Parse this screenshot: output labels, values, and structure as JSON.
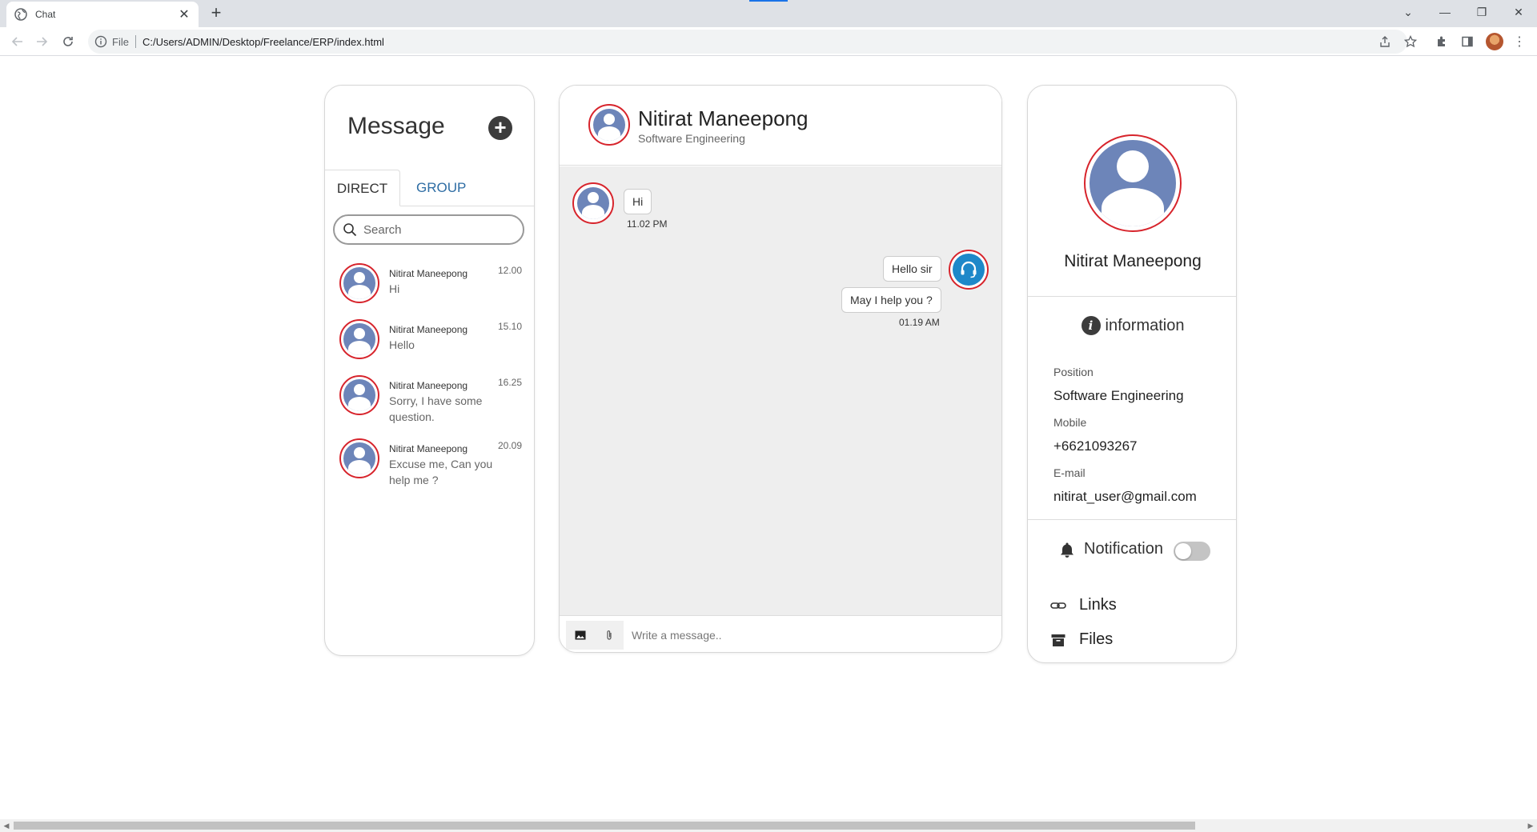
{
  "browser": {
    "tab_title": "Chat",
    "url_scheme": "File",
    "url": "C:/Users/ADMIN/Desktop/Freelance/ERP/index.html"
  },
  "left": {
    "title": "Message",
    "tabs": [
      {
        "label": "DIRECT",
        "active": true
      },
      {
        "label": "GROUP",
        "active": false
      }
    ],
    "search_placeholder": "Search",
    "conversations": [
      {
        "name": "Nitirat Maneepong",
        "time": "12.00",
        "message": "Hi"
      },
      {
        "name": "Nitirat Maneepong",
        "time": "15.10",
        "message": "Hello"
      },
      {
        "name": "Nitirat Maneepong",
        "time": "16.25",
        "message": "Sorry, I have some question."
      },
      {
        "name": "Nitirat Maneepong",
        "time": "20.09",
        "message": "Excuse me, Can you help me ?"
      }
    ]
  },
  "chat": {
    "contact_name": "Nitirat Maneepong",
    "contact_role": "Software Engineering",
    "messages": [
      {
        "from": "contact",
        "text": "Hi",
        "time": "11.02 PM"
      },
      {
        "from": "agent",
        "text": "Hello sir"
      },
      {
        "from": "agent",
        "text": "May I help you ?",
        "time": "01.19 AM"
      }
    ],
    "composer_placeholder": "Write a message.."
  },
  "profile": {
    "name": "Nitirat Maneepong",
    "info_heading": "information",
    "fields": [
      {
        "label": "Position",
        "value": "Software Engineering"
      },
      {
        "label": "Mobile",
        "value": "+6621093267"
      },
      {
        "label": "E-mail",
        "value": "nitirat_user@gmail.com"
      }
    ],
    "notification_label": "Notification",
    "notification_on": false,
    "links_label": "Links",
    "files_label": "Files"
  },
  "colors": {
    "avatar_ring": "#d7242c",
    "avatar_fill": "#6d85b9",
    "agent_fill": "#1e88c9",
    "tab_link": "#2e6da4",
    "chat_bg": "#eeeeee"
  }
}
